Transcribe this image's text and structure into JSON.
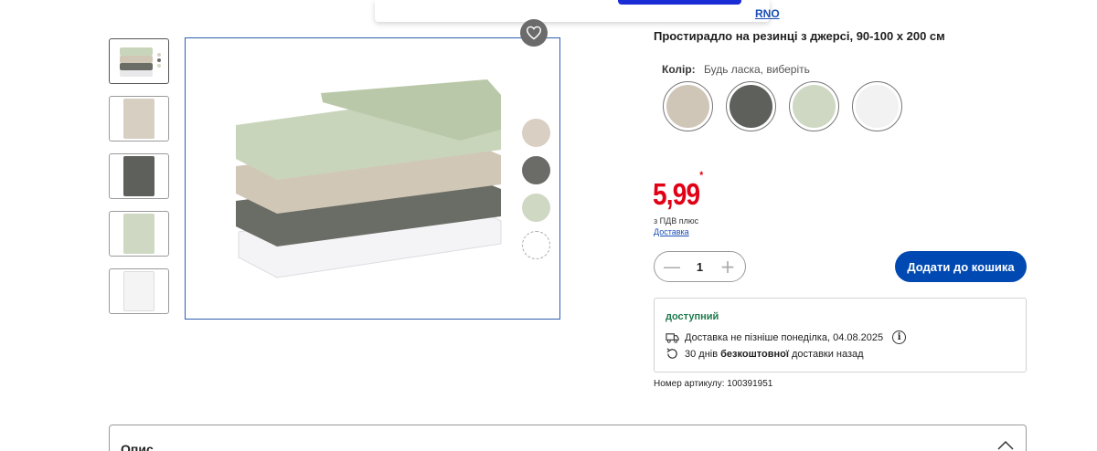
{
  "popup": {
    "brand_link": "RNO"
  },
  "product": {
    "title": "Простирадло на резинці з джерсі, 90-100 x 200 см",
    "color_label": "Колір:",
    "color_value": "Будь ласка, виберіть",
    "colors": [
      "#cfc6b8",
      "#5d605b",
      "#cfd8c3",
      "#f2f2f2"
    ]
  },
  "gallery": {
    "thumbnail_colors": [
      "#b8b3a8",
      "#d6cfc2",
      "#5d605b",
      "#cfd8c3",
      "#f4f4f4"
    ],
    "color_dots": [
      "#d9cfc3",
      "#6b6b67",
      "#cfd8c3",
      "#ffffff"
    ],
    "stack_colors": [
      "#c9d5bb",
      "#d1c7b7",
      "#6a6d66",
      "#f4f4f6"
    ]
  },
  "price": {
    "amount": "5,99",
    "asterisk": "*",
    "vat_text": "з ПДВ плюс",
    "delivery_link": "Доставка"
  },
  "quantity": {
    "minus": "—",
    "value": "1",
    "plus": "+"
  },
  "cart": {
    "button_label": "Додати до кошика"
  },
  "availability": {
    "status": "доступний",
    "delivery_line": "Доставка не пізніше понеділка, 04.08.2025",
    "return_prefix": "30 днів ",
    "return_bold": "безкоштовної",
    "return_suffix": " доставки назад"
  },
  "article": {
    "text": "Номер артикулу: 100391951"
  },
  "description": {
    "title": "Опис"
  },
  "colors": {
    "price_red": "#e10015",
    "primary_blue": "#0049b2",
    "available_green": "#1f7a4d"
  }
}
